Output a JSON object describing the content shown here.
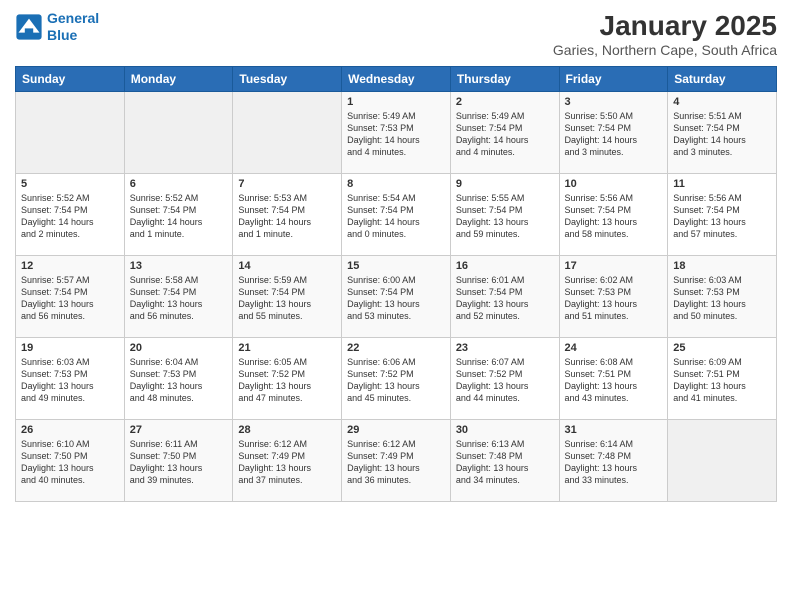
{
  "header": {
    "logo_line1": "General",
    "logo_line2": "Blue",
    "title": "January 2025",
    "subtitle": "Garies, Northern Cape, South Africa"
  },
  "weekdays": [
    "Sunday",
    "Monday",
    "Tuesday",
    "Wednesday",
    "Thursday",
    "Friday",
    "Saturday"
  ],
  "weeks": [
    [
      {
        "day": "",
        "info": ""
      },
      {
        "day": "",
        "info": ""
      },
      {
        "day": "",
        "info": ""
      },
      {
        "day": "1",
        "info": "Sunrise: 5:49 AM\nSunset: 7:53 PM\nDaylight: 14 hours\nand 4 minutes."
      },
      {
        "day": "2",
        "info": "Sunrise: 5:49 AM\nSunset: 7:54 PM\nDaylight: 14 hours\nand 4 minutes."
      },
      {
        "day": "3",
        "info": "Sunrise: 5:50 AM\nSunset: 7:54 PM\nDaylight: 14 hours\nand 3 minutes."
      },
      {
        "day": "4",
        "info": "Sunrise: 5:51 AM\nSunset: 7:54 PM\nDaylight: 14 hours\nand 3 minutes."
      }
    ],
    [
      {
        "day": "5",
        "info": "Sunrise: 5:52 AM\nSunset: 7:54 PM\nDaylight: 14 hours\nand 2 minutes."
      },
      {
        "day": "6",
        "info": "Sunrise: 5:52 AM\nSunset: 7:54 PM\nDaylight: 14 hours\nand 1 minute."
      },
      {
        "day": "7",
        "info": "Sunrise: 5:53 AM\nSunset: 7:54 PM\nDaylight: 14 hours\nand 1 minute."
      },
      {
        "day": "8",
        "info": "Sunrise: 5:54 AM\nSunset: 7:54 PM\nDaylight: 14 hours\nand 0 minutes."
      },
      {
        "day": "9",
        "info": "Sunrise: 5:55 AM\nSunset: 7:54 PM\nDaylight: 13 hours\nand 59 minutes."
      },
      {
        "day": "10",
        "info": "Sunrise: 5:56 AM\nSunset: 7:54 PM\nDaylight: 13 hours\nand 58 minutes."
      },
      {
        "day": "11",
        "info": "Sunrise: 5:56 AM\nSunset: 7:54 PM\nDaylight: 13 hours\nand 57 minutes."
      }
    ],
    [
      {
        "day": "12",
        "info": "Sunrise: 5:57 AM\nSunset: 7:54 PM\nDaylight: 13 hours\nand 56 minutes."
      },
      {
        "day": "13",
        "info": "Sunrise: 5:58 AM\nSunset: 7:54 PM\nDaylight: 13 hours\nand 56 minutes."
      },
      {
        "day": "14",
        "info": "Sunrise: 5:59 AM\nSunset: 7:54 PM\nDaylight: 13 hours\nand 55 minutes."
      },
      {
        "day": "15",
        "info": "Sunrise: 6:00 AM\nSunset: 7:54 PM\nDaylight: 13 hours\nand 53 minutes."
      },
      {
        "day": "16",
        "info": "Sunrise: 6:01 AM\nSunset: 7:54 PM\nDaylight: 13 hours\nand 52 minutes."
      },
      {
        "day": "17",
        "info": "Sunrise: 6:02 AM\nSunset: 7:53 PM\nDaylight: 13 hours\nand 51 minutes."
      },
      {
        "day": "18",
        "info": "Sunrise: 6:03 AM\nSunset: 7:53 PM\nDaylight: 13 hours\nand 50 minutes."
      }
    ],
    [
      {
        "day": "19",
        "info": "Sunrise: 6:03 AM\nSunset: 7:53 PM\nDaylight: 13 hours\nand 49 minutes."
      },
      {
        "day": "20",
        "info": "Sunrise: 6:04 AM\nSunset: 7:53 PM\nDaylight: 13 hours\nand 48 minutes."
      },
      {
        "day": "21",
        "info": "Sunrise: 6:05 AM\nSunset: 7:52 PM\nDaylight: 13 hours\nand 47 minutes."
      },
      {
        "day": "22",
        "info": "Sunrise: 6:06 AM\nSunset: 7:52 PM\nDaylight: 13 hours\nand 45 minutes."
      },
      {
        "day": "23",
        "info": "Sunrise: 6:07 AM\nSunset: 7:52 PM\nDaylight: 13 hours\nand 44 minutes."
      },
      {
        "day": "24",
        "info": "Sunrise: 6:08 AM\nSunset: 7:51 PM\nDaylight: 13 hours\nand 43 minutes."
      },
      {
        "day": "25",
        "info": "Sunrise: 6:09 AM\nSunset: 7:51 PM\nDaylight: 13 hours\nand 41 minutes."
      }
    ],
    [
      {
        "day": "26",
        "info": "Sunrise: 6:10 AM\nSunset: 7:50 PM\nDaylight: 13 hours\nand 40 minutes."
      },
      {
        "day": "27",
        "info": "Sunrise: 6:11 AM\nSunset: 7:50 PM\nDaylight: 13 hours\nand 39 minutes."
      },
      {
        "day": "28",
        "info": "Sunrise: 6:12 AM\nSunset: 7:49 PM\nDaylight: 13 hours\nand 37 minutes."
      },
      {
        "day": "29",
        "info": "Sunrise: 6:12 AM\nSunset: 7:49 PM\nDaylight: 13 hours\nand 36 minutes."
      },
      {
        "day": "30",
        "info": "Sunrise: 6:13 AM\nSunset: 7:48 PM\nDaylight: 13 hours\nand 34 minutes."
      },
      {
        "day": "31",
        "info": "Sunrise: 6:14 AM\nSunset: 7:48 PM\nDaylight: 13 hours\nand 33 minutes."
      },
      {
        "day": "",
        "info": ""
      }
    ]
  ]
}
